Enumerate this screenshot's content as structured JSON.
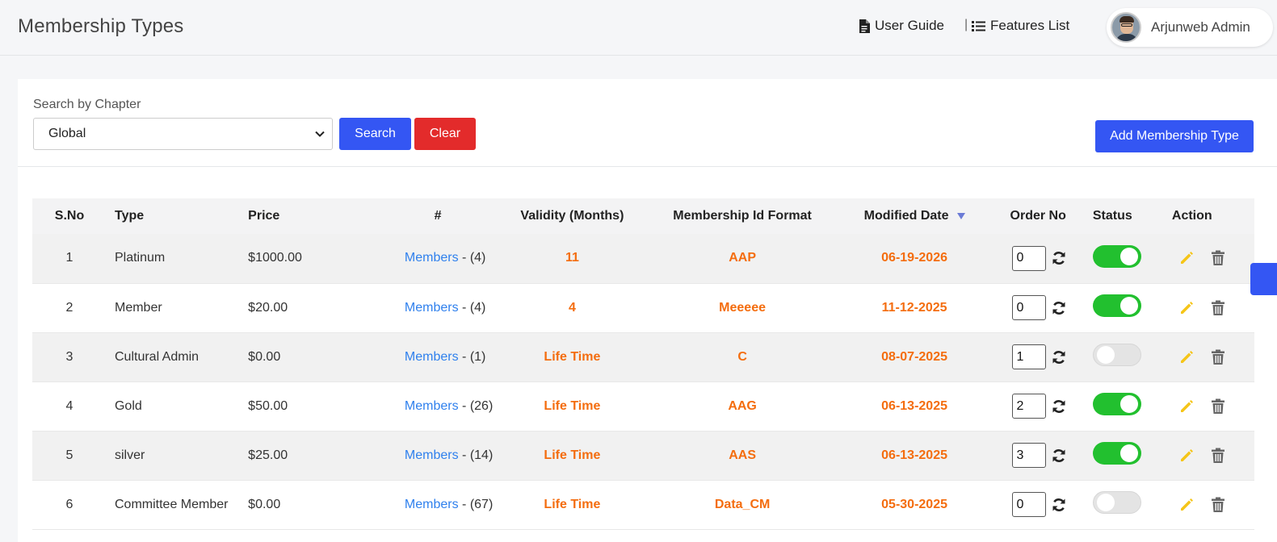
{
  "header": {
    "title": "Membership Types",
    "user_guide": "User Guide",
    "features_list": "Features List",
    "separator": "|",
    "user_name": "Arjunweb Admin"
  },
  "filter": {
    "label": "Search by Chapter",
    "selected": "Global",
    "search_label": "Search",
    "clear_label": "Clear",
    "add_label": "Add Membership Type"
  },
  "table": {
    "columns": [
      "S.No",
      "Type",
      "Price",
      "#",
      "Validity (Months)",
      "Membership Id Format",
      "Modified Date",
      "Order No",
      "Status",
      "Action"
    ],
    "rows": [
      {
        "sno": "1",
        "type": "Platinum",
        "price": "$1000.00",
        "members_link": "Members",
        "members_count": " - (4)",
        "validity": "11",
        "id_format": "AAP",
        "modified": "06-19-2026",
        "order": "0",
        "status": "on"
      },
      {
        "sno": "2",
        "type": "Member",
        "price": "$20.00",
        "members_link": "Members",
        "members_count": " - (4)",
        "validity": "4",
        "id_format": "Meeeee",
        "modified": "11-12-2025",
        "order": "0",
        "status": "on"
      },
      {
        "sno": "3",
        "type": "Cultural Admin",
        "price": "$0.00",
        "members_link": "Members",
        "members_count": " - (1)",
        "validity": "Life Time",
        "id_format": "C",
        "modified": "08-07-2025",
        "order": "1",
        "status": "off"
      },
      {
        "sno": "4",
        "type": "Gold",
        "price": "$50.00",
        "members_link": "Members",
        "members_count": " - (26)",
        "validity": "Life Time",
        "id_format": "AAG",
        "modified": "06-13-2025",
        "order": "2",
        "status": "on"
      },
      {
        "sno": "5",
        "type": "silver",
        "price": "$25.00",
        "members_link": "Members",
        "members_count": " - (14)",
        "validity": "Life Time",
        "id_format": "AAS",
        "modified": "06-13-2025",
        "order": "3",
        "status": "on"
      },
      {
        "sno": "6",
        "type": "Committee Member",
        "price": "$0.00",
        "members_link": "Members",
        "members_count": " - (67)",
        "validity": "Life Time",
        "id_format": "Data_CM",
        "modified": "05-30-2025",
        "order": "0",
        "status": "off"
      }
    ]
  },
  "colors": {
    "primary": "#3456f3",
    "danger": "#e32b2b",
    "highlight": "#f46d0f",
    "toggle_on": "#22c02f",
    "link": "#2f80ed",
    "edit_icon": "#f5c518"
  },
  "icons": {
    "user_guide": "document-icon",
    "features": "list-icon",
    "order_refresh": "refresh-icon",
    "edit": "pencil-icon",
    "delete": "trash-icon",
    "sort": "sort-down-icon"
  }
}
